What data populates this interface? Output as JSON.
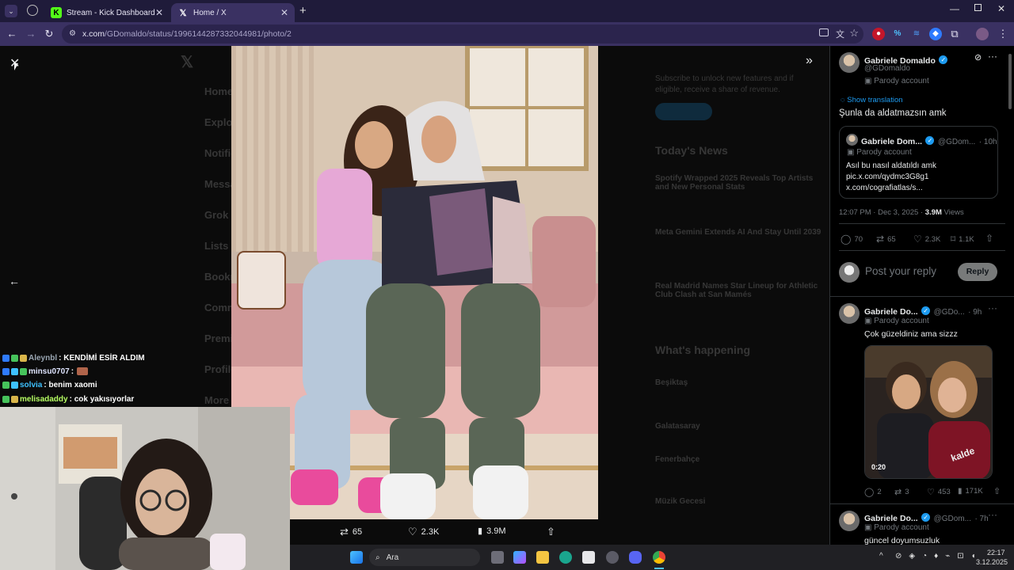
{
  "browser": {
    "tabs": [
      {
        "label": "Stream - Kick Dashboard",
        "active": false
      },
      {
        "label": "Home / X",
        "active": true
      }
    ],
    "url_host": "x.com",
    "url_path": "/GDomaldo/status/1996144287332044981/photo/2"
  },
  "media_bar": {
    "replies": "",
    "reposts": "65",
    "likes": "2.3K",
    "views": "3.9M"
  },
  "ghost_nav": [
    "Home",
    "Explore",
    "Notifications",
    "Messages",
    "Grok",
    "Lists",
    "Bookmarks",
    "Communities",
    "Premium",
    "Profile",
    "More"
  ],
  "ghost_right": {
    "premium_text_1": "Subscribe to unlock new features and if",
    "premium_text_2": "eligible, receive a share of revenue.",
    "news_title": "Today's News",
    "news": [
      "Spotify Wrapped 2025 Reveals Top Artists and New Personal Stats",
      "Meta Gemini Extends AI And Stay Until 2039",
      "Real Madrid Names Star Lineup for Athletic Club Clash at San Mamés"
    ],
    "happening_title": "What's happening",
    "trends": [
      "Beşiktaş",
      "Galatasaray",
      "Fenerbahçe",
      "Müzik Gecesi"
    ]
  },
  "chat": [
    {
      "user": "Aleynbl",
      "user_color": "#9aa6b2",
      "message": ": KENDİMİ ESİR ALDIM"
    },
    {
      "user": "minsu0707",
      "user_color": "#dfe4ff",
      "message": ":"
    },
    {
      "user": "solvia",
      "user_color": "#3ec1ff",
      "message": ": benim xaomi"
    },
    {
      "user": "melisadaddy",
      "user_color": "#b6ff63",
      "message": ": cok yakısıyorlar"
    }
  ],
  "main_post": {
    "name": "Gabriele Domaldo",
    "handle": "@GDomaldo",
    "parody": "Parody account",
    "show_translation": "Show translation",
    "text": "Şunla da aldatmazsın amk",
    "quote": {
      "name": "Gabriele Dom...",
      "handle": "@GDom...",
      "time": "· 10h",
      "parody": "Parody account",
      "line1": "Asıl bu nasıl aldatıldı amk",
      "line2": "pic.x.com/qydmc3G8g1",
      "line3": "x.com/cografiatlas/s..."
    },
    "timestamp": "12:07 PM · Dec 3, 2025 ·",
    "views_num": "3.9M",
    "views_label": "Views",
    "replies": "70",
    "reposts": "65",
    "likes": "2.3K",
    "bookmarks": "1.1K",
    "reply_placeholder": "Post your reply",
    "reply_button": "Reply"
  },
  "reply1": {
    "name": "Gabriele Do...",
    "handle": "@GDo...",
    "time": "· 9h",
    "parody": "Parody account",
    "text": "Çok güzeldiniz ama sizzz",
    "video_time": "0:20",
    "jersey_text": "kalde",
    "replies": "2",
    "reposts": "3",
    "likes": "453",
    "views": "171K"
  },
  "reply2": {
    "name": "Gabriele Do...",
    "handle": "@GDom...",
    "time": "· 7h",
    "parody": "Parody account",
    "text": "güncel doyumsuzluk"
  },
  "taskbar": {
    "search_label": "Ara",
    "time": "22:17",
    "date": "3.12.2025"
  }
}
